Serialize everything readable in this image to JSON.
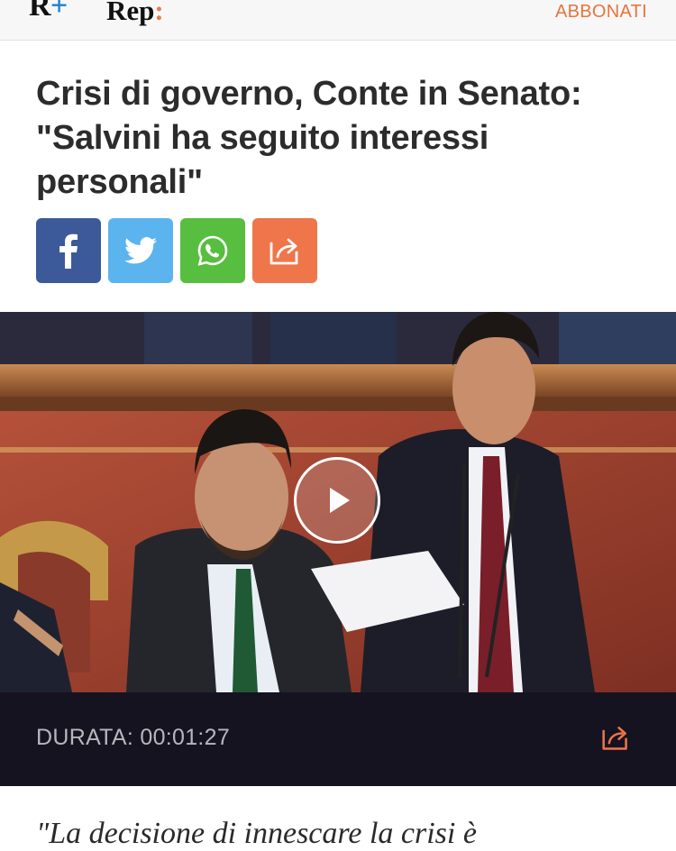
{
  "header": {
    "logo_primary": "R",
    "logo_secondary": "Rep",
    "subscribe_label": "ABBONATI",
    "accent_color": "#e9733e"
  },
  "article": {
    "title": "Crisi di governo, Conte in Senato: \"Salvini ha seguito interessi personali\"",
    "share_buttons": [
      {
        "icon": "facebook-icon",
        "color": "#3c5a99"
      },
      {
        "icon": "twitter-icon",
        "color": "#5bb4ee"
      },
      {
        "icon": "whatsapp-icon",
        "color": "#57be3f"
      },
      {
        "icon": "share-icon",
        "color": "#ee764a"
      }
    ],
    "video": {
      "duration_label": "DURATA: 00:01:27"
    },
    "body_quote": "\"La decisione di innescare la crisi è"
  }
}
